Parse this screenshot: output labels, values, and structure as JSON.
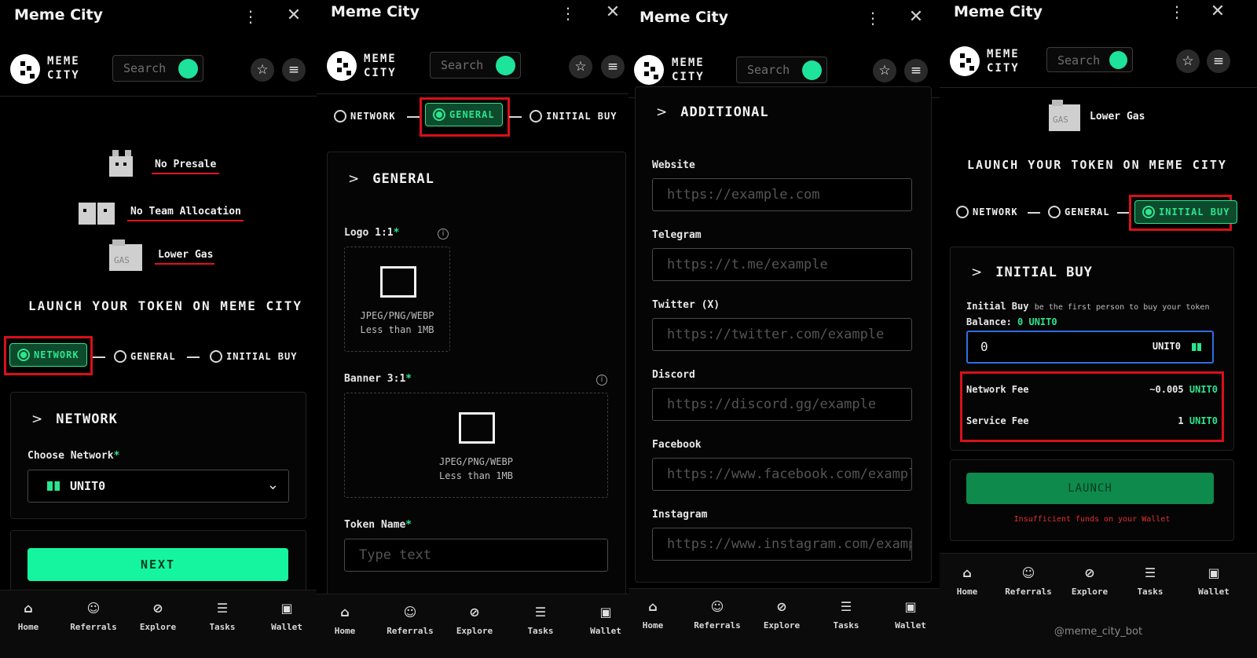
{
  "app_title": "Meme City",
  "logo_text": [
    "MEME",
    "CITY"
  ],
  "search_placeholder": "Search",
  "nav": [
    "Home",
    "Referrals",
    "Explore",
    "Tasks",
    "Wallet"
  ],
  "steps": [
    "NETWORK",
    "GENERAL",
    "INITIAL BUY"
  ],
  "panel1": {
    "features": [
      "No Presale",
      "No Team Allocation",
      "Lower Gas"
    ],
    "launch_title": "LAUNCH YOUR TOKEN ON MEME CITY",
    "section_title": "NETWORK",
    "choose_network_label": "Choose Network",
    "selected_network": "UNIT0",
    "next_label": "NEXT"
  },
  "panel2": {
    "section_title": "GENERAL",
    "logo_label": "Logo 1:1",
    "banner_label": "Banner 3:1",
    "formats": "JPEG/PNG/WEBP",
    "size_limit": "Less than 1MB",
    "token_name_label": "Token Name",
    "token_name_placeholder": "Type text"
  },
  "panel3": {
    "section_title": "ADDITIONAL",
    "fields": [
      {
        "label": "Website",
        "placeholder": "https://example.com"
      },
      {
        "label": "Telegram",
        "placeholder": "https://t.me/example"
      },
      {
        "label": "Twitter (X)",
        "placeholder": "https://twitter.com/example"
      },
      {
        "label": "Discord",
        "placeholder": "https://discord.gg/example"
      },
      {
        "label": "Facebook",
        "placeholder": "https://www.facebook.com/example"
      },
      {
        "label": "Instagram",
        "placeholder": "https://www.instagram.com/example"
      }
    ]
  },
  "panel4": {
    "feature": "Lower Gas",
    "launch_title": "LAUNCH YOUR TOKEN ON MEME CITY",
    "section_title": "INITIAL BUY",
    "initial_buy_label": "Initial Buy",
    "initial_buy_hint": "be the first person to buy your token",
    "balance_label": "Balance:",
    "balance_value": "0 UNIT0",
    "amount_value": "0",
    "amount_unit": "UNIT0",
    "network_fee_label": "Network Fee",
    "network_fee_value": "~0.005",
    "service_fee_label": "Service Fee",
    "service_fee_value": "1",
    "fee_unit": "UNIT0",
    "launch_label": "LAUNCH",
    "error_text": "Insufficient funds on your Wallet",
    "bot_handle": "@meme_city_bot"
  },
  "colors": {
    "accent": "#2be58f",
    "bright_green": "#15f5a0",
    "highlight_red": "#d8101a",
    "error": "#e03030"
  }
}
